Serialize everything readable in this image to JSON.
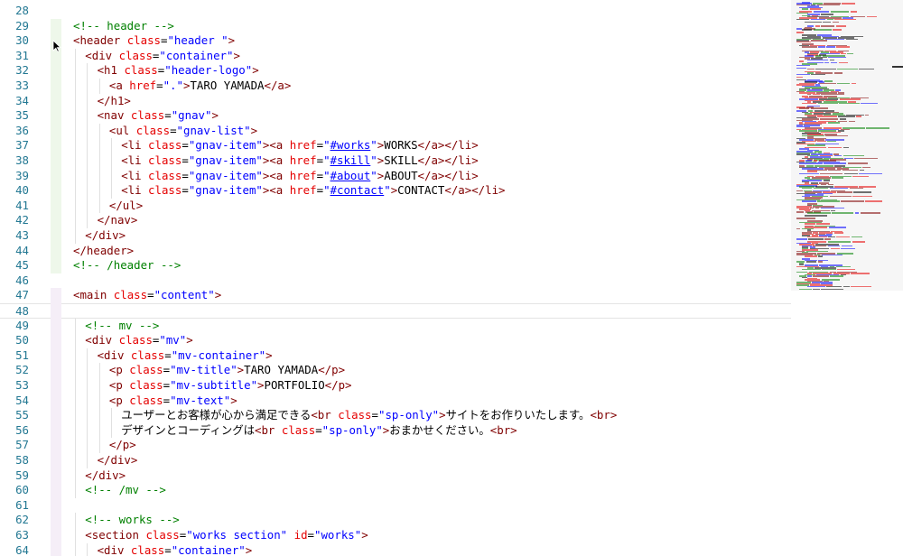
{
  "editor": {
    "lines": [
      {
        "n": "28",
        "tokens": []
      },
      {
        "n": "29",
        "tokens": [
          {
            "c": "t-comment",
            "t": "<!-- header -->"
          }
        ]
      },
      {
        "n": "30",
        "tokens": [
          {
            "c": "t-tag",
            "t": "<header"
          },
          {
            "c": "t-text",
            "t": " "
          },
          {
            "c": "t-attr",
            "t": "class"
          },
          {
            "c": "t-text",
            "t": "="
          },
          {
            "c": "t-str",
            "t": "\"header \""
          },
          {
            "c": "t-tag",
            "t": ">"
          }
        ]
      },
      {
        "n": "31",
        "indent": 1,
        "tokens": [
          {
            "c": "t-tag",
            "t": "<div"
          },
          {
            "c": "t-text",
            "t": " "
          },
          {
            "c": "t-attr",
            "t": "class"
          },
          {
            "c": "t-text",
            "t": "="
          },
          {
            "c": "t-str",
            "t": "\"container\""
          },
          {
            "c": "t-tag",
            "t": ">"
          }
        ]
      },
      {
        "n": "32",
        "indent": 2,
        "tokens": [
          {
            "c": "t-tag",
            "t": "<h1"
          },
          {
            "c": "t-text",
            "t": " "
          },
          {
            "c": "t-attr",
            "t": "class"
          },
          {
            "c": "t-text",
            "t": "="
          },
          {
            "c": "t-str",
            "t": "\"header-logo\""
          },
          {
            "c": "t-tag",
            "t": ">"
          }
        ]
      },
      {
        "n": "33",
        "indent": 3,
        "tokens": [
          {
            "c": "t-tag",
            "t": "<a"
          },
          {
            "c": "t-text",
            "t": " "
          },
          {
            "c": "t-attr",
            "t": "href"
          },
          {
            "c": "t-text",
            "t": "="
          },
          {
            "c": "t-str",
            "t": "\".\""
          },
          {
            "c": "t-tag",
            "t": ">"
          },
          {
            "c": "t-text",
            "t": "TARO YAMADA"
          },
          {
            "c": "t-tag",
            "t": "</a>"
          }
        ]
      },
      {
        "n": "34",
        "indent": 2,
        "tokens": [
          {
            "c": "t-tag",
            "t": "</h1>"
          }
        ]
      },
      {
        "n": "35",
        "indent": 2,
        "tokens": [
          {
            "c": "t-tag",
            "t": "<nav"
          },
          {
            "c": "t-text",
            "t": " "
          },
          {
            "c": "t-attr",
            "t": "class"
          },
          {
            "c": "t-text",
            "t": "="
          },
          {
            "c": "t-str",
            "t": "\"gnav\""
          },
          {
            "c": "t-tag",
            "t": ">"
          }
        ]
      },
      {
        "n": "36",
        "indent": 3,
        "tokens": [
          {
            "c": "t-tag",
            "t": "<ul"
          },
          {
            "c": "t-text",
            "t": " "
          },
          {
            "c": "t-attr",
            "t": "class"
          },
          {
            "c": "t-text",
            "t": "="
          },
          {
            "c": "t-str",
            "t": "\"gnav-list\""
          },
          {
            "c": "t-tag",
            "t": ">"
          }
        ]
      },
      {
        "n": "37",
        "indent": 4,
        "tokens": [
          {
            "c": "t-tag",
            "t": "<li"
          },
          {
            "c": "t-text",
            "t": " "
          },
          {
            "c": "t-attr",
            "t": "class"
          },
          {
            "c": "t-text",
            "t": "="
          },
          {
            "c": "t-str",
            "t": "\"gnav-item\""
          },
          {
            "c": "t-tag",
            "t": "><a"
          },
          {
            "c": "t-text",
            "t": " "
          },
          {
            "c": "t-attr",
            "t": "href"
          },
          {
            "c": "t-text",
            "t": "="
          },
          {
            "c": "t-str",
            "t": "\""
          },
          {
            "c": "t-link",
            "t": "#works"
          },
          {
            "c": "t-str",
            "t": "\""
          },
          {
            "c": "t-tag",
            "t": ">"
          },
          {
            "c": "t-text",
            "t": "WORKS"
          },
          {
            "c": "t-tag",
            "t": "</a></li>"
          }
        ]
      },
      {
        "n": "38",
        "indent": 4,
        "tokens": [
          {
            "c": "t-tag",
            "t": "<li"
          },
          {
            "c": "t-text",
            "t": " "
          },
          {
            "c": "t-attr",
            "t": "class"
          },
          {
            "c": "t-text",
            "t": "="
          },
          {
            "c": "t-str",
            "t": "\"gnav-item\""
          },
          {
            "c": "t-tag",
            "t": "><a"
          },
          {
            "c": "t-text",
            "t": " "
          },
          {
            "c": "t-attr",
            "t": "href"
          },
          {
            "c": "t-text",
            "t": "="
          },
          {
            "c": "t-str",
            "t": "\""
          },
          {
            "c": "t-link",
            "t": "#skill"
          },
          {
            "c": "t-str",
            "t": "\""
          },
          {
            "c": "t-tag",
            "t": ">"
          },
          {
            "c": "t-text",
            "t": "SKILL"
          },
          {
            "c": "t-tag",
            "t": "</a></li>"
          }
        ]
      },
      {
        "n": "39",
        "indent": 4,
        "tokens": [
          {
            "c": "t-tag",
            "t": "<li"
          },
          {
            "c": "t-text",
            "t": " "
          },
          {
            "c": "t-attr",
            "t": "class"
          },
          {
            "c": "t-text",
            "t": "="
          },
          {
            "c": "t-str",
            "t": "\"gnav-item\""
          },
          {
            "c": "t-tag",
            "t": "><a"
          },
          {
            "c": "t-text",
            "t": " "
          },
          {
            "c": "t-attr",
            "t": "href"
          },
          {
            "c": "t-text",
            "t": "="
          },
          {
            "c": "t-str",
            "t": "\""
          },
          {
            "c": "t-link",
            "t": "#about"
          },
          {
            "c": "t-str",
            "t": "\""
          },
          {
            "c": "t-tag",
            "t": ">"
          },
          {
            "c": "t-text",
            "t": "ABOUT"
          },
          {
            "c": "t-tag",
            "t": "</a></li>"
          }
        ]
      },
      {
        "n": "40",
        "indent": 4,
        "tokens": [
          {
            "c": "t-tag",
            "t": "<li"
          },
          {
            "c": "t-text",
            "t": " "
          },
          {
            "c": "t-attr",
            "t": "class"
          },
          {
            "c": "t-text",
            "t": "="
          },
          {
            "c": "t-str",
            "t": "\"gnav-item\""
          },
          {
            "c": "t-tag",
            "t": "><a"
          },
          {
            "c": "t-text",
            "t": " "
          },
          {
            "c": "t-attr",
            "t": "href"
          },
          {
            "c": "t-text",
            "t": "="
          },
          {
            "c": "t-str",
            "t": "\""
          },
          {
            "c": "t-link",
            "t": "#contact"
          },
          {
            "c": "t-str",
            "t": "\""
          },
          {
            "c": "t-tag",
            "t": ">"
          },
          {
            "c": "t-text",
            "t": "CONTACT"
          },
          {
            "c": "t-tag",
            "t": "</a></li>"
          }
        ]
      },
      {
        "n": "41",
        "indent": 3,
        "tokens": [
          {
            "c": "t-tag",
            "t": "</ul>"
          }
        ]
      },
      {
        "n": "42",
        "indent": 2,
        "tokens": [
          {
            "c": "t-tag",
            "t": "</nav>"
          }
        ]
      },
      {
        "n": "43",
        "indent": 1,
        "tokens": [
          {
            "c": "t-tag",
            "t": "</div>"
          }
        ]
      },
      {
        "n": "44",
        "tokens": [
          {
            "c": "t-tag",
            "t": "</header>"
          }
        ]
      },
      {
        "n": "45",
        "tokens": [
          {
            "c": "t-comment",
            "t": "<!-- /header -->"
          }
        ]
      },
      {
        "n": "46",
        "tokens": []
      },
      {
        "n": "47",
        "tokens": [
          {
            "c": "t-tag",
            "t": "<main"
          },
          {
            "c": "t-text",
            "t": " "
          },
          {
            "c": "t-attr",
            "t": "class"
          },
          {
            "c": "t-text",
            "t": "="
          },
          {
            "c": "t-str",
            "t": "\"content\""
          },
          {
            "c": "t-tag",
            "t": ">"
          }
        ]
      },
      {
        "n": "48",
        "current": true,
        "tokens": []
      },
      {
        "n": "49",
        "indent": 1,
        "tokens": [
          {
            "c": "t-comment",
            "t": "<!-- mv -->"
          }
        ]
      },
      {
        "n": "50",
        "indent": 1,
        "tokens": [
          {
            "c": "t-tag",
            "t": "<div"
          },
          {
            "c": "t-text",
            "t": " "
          },
          {
            "c": "t-attr",
            "t": "class"
          },
          {
            "c": "t-text",
            "t": "="
          },
          {
            "c": "t-str",
            "t": "\"mv\""
          },
          {
            "c": "t-tag",
            "t": ">"
          }
        ]
      },
      {
        "n": "51",
        "indent": 2,
        "tokens": [
          {
            "c": "t-tag",
            "t": "<div"
          },
          {
            "c": "t-text",
            "t": " "
          },
          {
            "c": "t-attr",
            "t": "class"
          },
          {
            "c": "t-text",
            "t": "="
          },
          {
            "c": "t-str",
            "t": "\"mv-container\""
          },
          {
            "c": "t-tag",
            "t": ">"
          }
        ]
      },
      {
        "n": "52",
        "indent": 3,
        "tokens": [
          {
            "c": "t-tag",
            "t": "<p"
          },
          {
            "c": "t-text",
            "t": " "
          },
          {
            "c": "t-attr",
            "t": "class"
          },
          {
            "c": "t-text",
            "t": "="
          },
          {
            "c": "t-str",
            "t": "\"mv-title\""
          },
          {
            "c": "t-tag",
            "t": ">"
          },
          {
            "c": "t-text",
            "t": "TARO YAMADA"
          },
          {
            "c": "t-tag",
            "t": "</p>"
          }
        ]
      },
      {
        "n": "53",
        "indent": 3,
        "tokens": [
          {
            "c": "t-tag",
            "t": "<p"
          },
          {
            "c": "t-text",
            "t": " "
          },
          {
            "c": "t-attr",
            "t": "class"
          },
          {
            "c": "t-text",
            "t": "="
          },
          {
            "c": "t-str",
            "t": "\"mv-subtitle\""
          },
          {
            "c": "t-tag",
            "t": ">"
          },
          {
            "c": "t-text",
            "t": "PORTFOLIO"
          },
          {
            "c": "t-tag",
            "t": "</p>"
          }
        ]
      },
      {
        "n": "54",
        "indent": 3,
        "tokens": [
          {
            "c": "t-tag",
            "t": "<p"
          },
          {
            "c": "t-text",
            "t": " "
          },
          {
            "c": "t-attr",
            "t": "class"
          },
          {
            "c": "t-text",
            "t": "="
          },
          {
            "c": "t-str",
            "t": "\"mv-text\""
          },
          {
            "c": "t-tag",
            "t": ">"
          }
        ]
      },
      {
        "n": "55",
        "indent": 4,
        "tokens": [
          {
            "c": "t-text",
            "t": "ユーザーとお客様が心から満足できる"
          },
          {
            "c": "t-tag",
            "t": "<br"
          },
          {
            "c": "t-text",
            "t": " "
          },
          {
            "c": "t-attr",
            "t": "class"
          },
          {
            "c": "t-text",
            "t": "="
          },
          {
            "c": "t-str",
            "t": "\"sp-only\""
          },
          {
            "c": "t-tag",
            "t": ">"
          },
          {
            "c": "t-text",
            "t": "サイトをお作りいたします。"
          },
          {
            "c": "t-tag",
            "t": "<br>"
          }
        ]
      },
      {
        "n": "56",
        "indent": 4,
        "tokens": [
          {
            "c": "t-text",
            "t": "デザインとコーディングは"
          },
          {
            "c": "t-tag",
            "t": "<br"
          },
          {
            "c": "t-text",
            "t": " "
          },
          {
            "c": "t-attr",
            "t": "class"
          },
          {
            "c": "t-text",
            "t": "="
          },
          {
            "c": "t-str",
            "t": "\"sp-only\""
          },
          {
            "c": "t-tag",
            "t": ">"
          },
          {
            "c": "t-text",
            "t": "おまかせください。"
          },
          {
            "c": "t-tag",
            "t": "<br>"
          }
        ]
      },
      {
        "n": "57",
        "indent": 3,
        "tokens": [
          {
            "c": "t-tag",
            "t": "</p>"
          }
        ]
      },
      {
        "n": "58",
        "indent": 2,
        "tokens": [
          {
            "c": "t-tag",
            "t": "</div>"
          }
        ]
      },
      {
        "n": "59",
        "indent": 1,
        "tokens": [
          {
            "c": "t-tag",
            "t": "</div>"
          }
        ]
      },
      {
        "n": "60",
        "indent": 1,
        "tokens": [
          {
            "c": "t-comment",
            "t": "<!-- /mv -->"
          }
        ]
      },
      {
        "n": "61",
        "tokens": []
      },
      {
        "n": "62",
        "indent": 1,
        "tokens": [
          {
            "c": "t-comment",
            "t": "<!-- works -->"
          }
        ]
      },
      {
        "n": "63",
        "indent": 1,
        "tokens": [
          {
            "c": "t-tag",
            "t": "<section"
          },
          {
            "c": "t-text",
            "t": " "
          },
          {
            "c": "t-attr",
            "t": "class"
          },
          {
            "c": "t-text",
            "t": "="
          },
          {
            "c": "t-str",
            "t": "\"works section\""
          },
          {
            "c": "t-text",
            "t": " "
          },
          {
            "c": "t-attr",
            "t": "id"
          },
          {
            "c": "t-text",
            "t": "="
          },
          {
            "c": "t-str",
            "t": "\"works\""
          },
          {
            "c": "t-tag",
            "t": ">"
          }
        ]
      },
      {
        "n": "64",
        "indent": 2,
        "tokens": [
          {
            "c": "t-tag",
            "t": "<div"
          },
          {
            "c": "t-text",
            "t": " "
          },
          {
            "c": "t-attr",
            "t": "class"
          },
          {
            "c": "t-text",
            "t": "="
          },
          {
            "c": "t-str",
            "t": "\"container\""
          },
          {
            "c": "t-tag",
            "t": ">"
          }
        ]
      }
    ]
  },
  "colors": {
    "line_number": "#237893",
    "comment": "#008000",
    "tag": "#800000",
    "attribute": "#e50000",
    "string": "#0000ff",
    "text": "#000000"
  },
  "icons": [
    "mouse-cursor-icon"
  ]
}
